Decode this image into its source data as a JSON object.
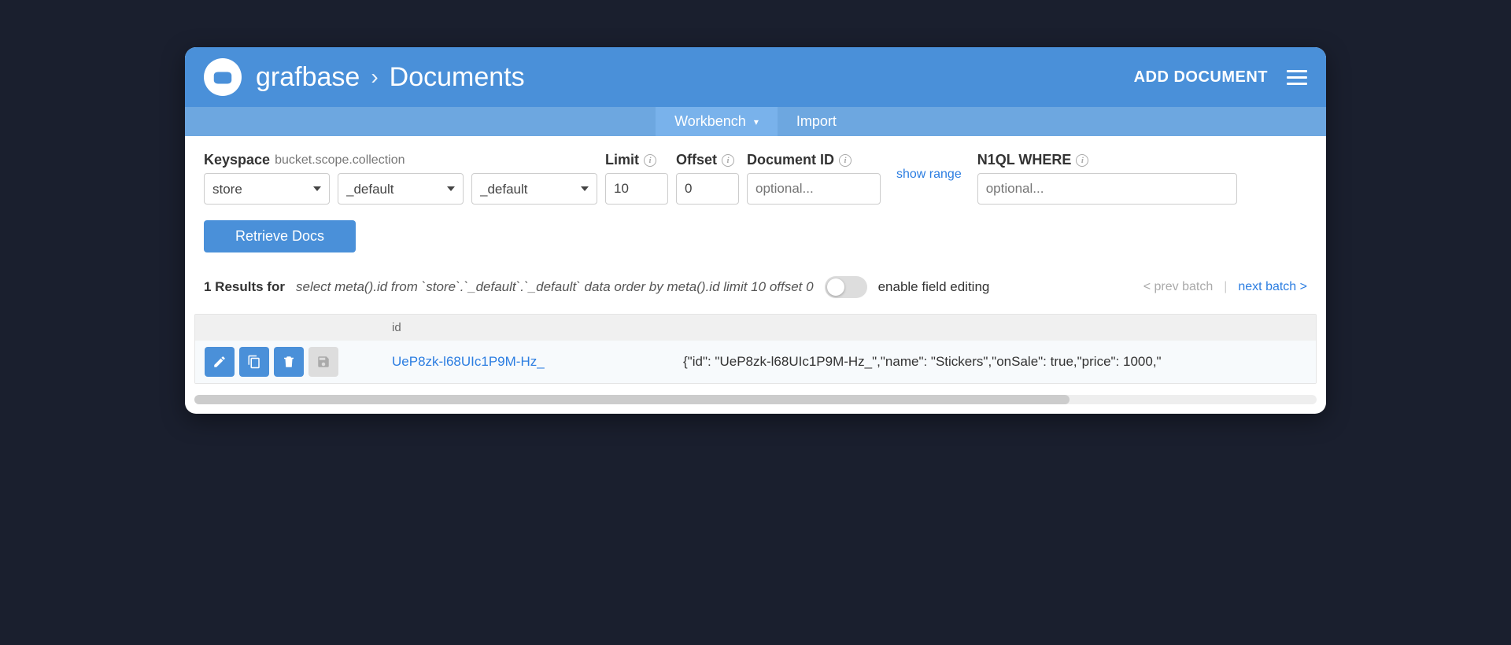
{
  "header": {
    "bucket": "grafbase",
    "page": "Documents",
    "add_label": "ADD DOCUMENT"
  },
  "submenu": {
    "workbench": "Workbench",
    "import": "Import"
  },
  "filters": {
    "keyspace_label": "Keyspace",
    "keyspace_sub": "bucket.scope.collection",
    "bucket": "store",
    "scope": "_default",
    "collection": "_default",
    "limit_label": "Limit",
    "limit": "10",
    "offset_label": "Offset",
    "offset": "0",
    "docid_label": "Document ID",
    "docid_placeholder": "optional...",
    "show_range": "show range",
    "where_label": "N1QL WHERE",
    "where_placeholder": "optional...",
    "retrieve": "Retrieve Docs"
  },
  "results": {
    "count_prefix": "1 Results for",
    "query": "select meta().id from `store`.`_default`.`_default` data order by meta().id limit 10 offset 0",
    "toggle_label": "enable field editing",
    "prev": "< prev batch",
    "next": "next batch >"
  },
  "table": {
    "header_id": "id",
    "rows": [
      {
        "id": "UeP8zk-l68UIc1P9M-Hz_",
        "json": "{\"id\": \"UeP8zk-l68UIc1P9M-Hz_\",\"name\": \"Stickers\",\"onSale\": true,\"price\": 1000,\""
      }
    ]
  }
}
